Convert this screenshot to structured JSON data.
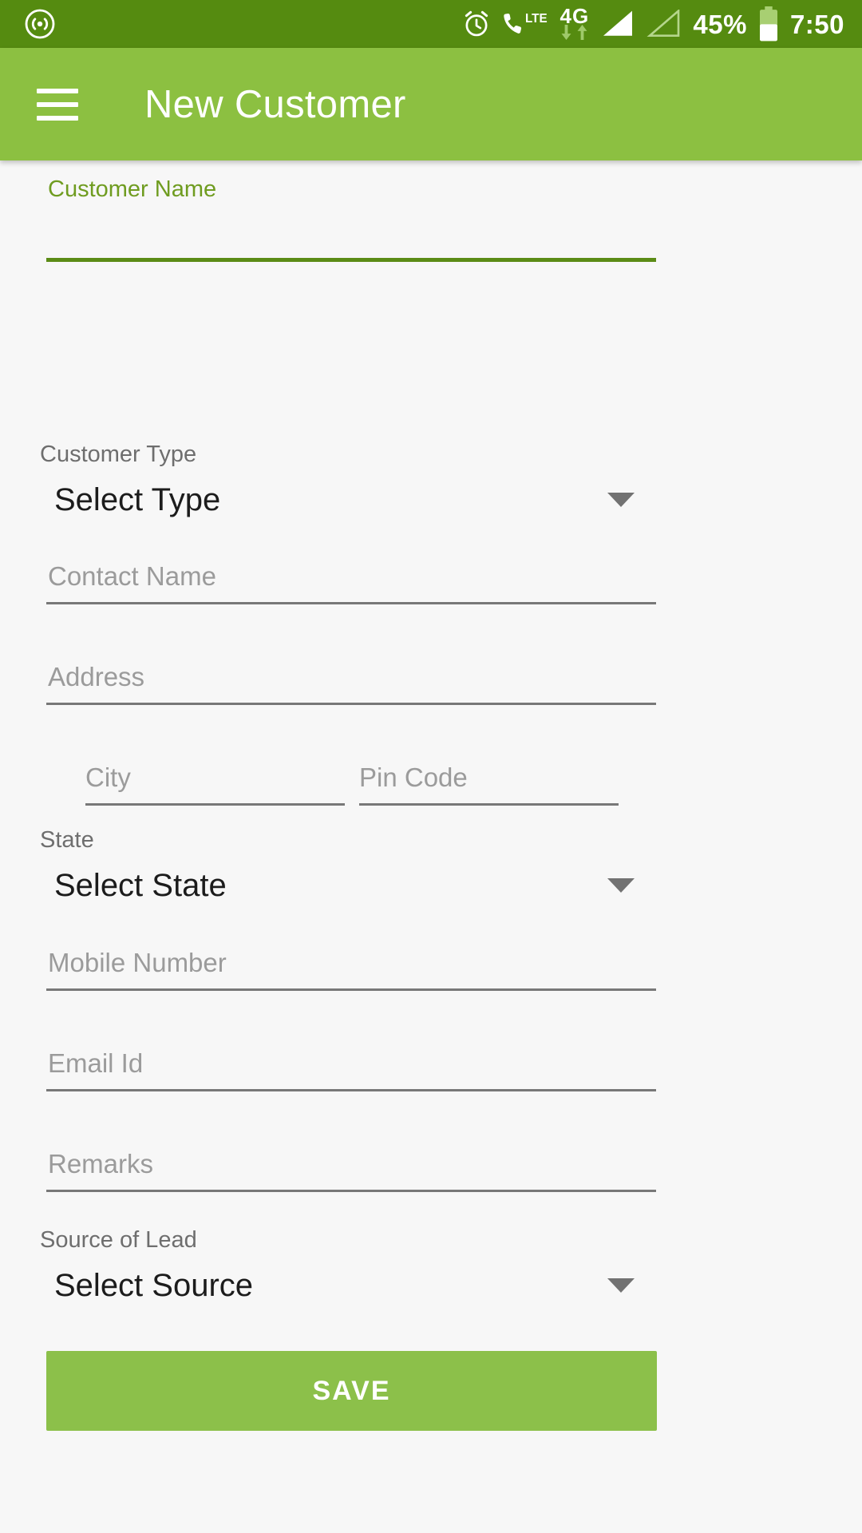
{
  "status_bar": {
    "cast_icon": "cast-icon",
    "alarm_icon": "alarm-icon",
    "call_lte_icon": "call-lte-icon",
    "network_label": "4G",
    "data_down_icon": "data-down-arrow-icon",
    "data_up_icon": "data-up-arrow-icon",
    "signal_icon": "signal-bars-icon",
    "signal_empty_icon": "signal-bars-empty-icon",
    "battery_percent": "45%",
    "battery_icon": "battery-icon",
    "time": "7:50",
    "background": "#558b10"
  },
  "app_bar": {
    "menu_icon": "hamburger-menu-icon",
    "title": "New Customer",
    "background": "#8cc041"
  },
  "form": {
    "customer_name": {
      "label": "Customer Name",
      "value": "",
      "accent": "#5b8c16"
    },
    "customer_type": {
      "label": "Customer Type",
      "value": "Select Type",
      "caret_icon": "dropdown-caret-icon"
    },
    "contact_name": {
      "placeholder": "Contact Name",
      "value": ""
    },
    "address": {
      "placeholder": "Address",
      "value": ""
    },
    "city": {
      "placeholder": "City",
      "value": ""
    },
    "pin_code": {
      "placeholder": "Pin Code",
      "value": ""
    },
    "state": {
      "label": "State",
      "value": "Select State",
      "caret_icon": "dropdown-caret-icon"
    },
    "mobile_number": {
      "placeholder": "Mobile Number",
      "value": ""
    },
    "email_id": {
      "placeholder": "Email Id",
      "value": ""
    },
    "remarks": {
      "placeholder": "Remarks",
      "value": ""
    },
    "source_of_lead": {
      "label": "Source of Lead",
      "value": "Select Source",
      "caret_icon": "dropdown-caret-icon"
    }
  },
  "actions": {
    "save_label": "SAVE",
    "save_color": "#8cc04a"
  }
}
